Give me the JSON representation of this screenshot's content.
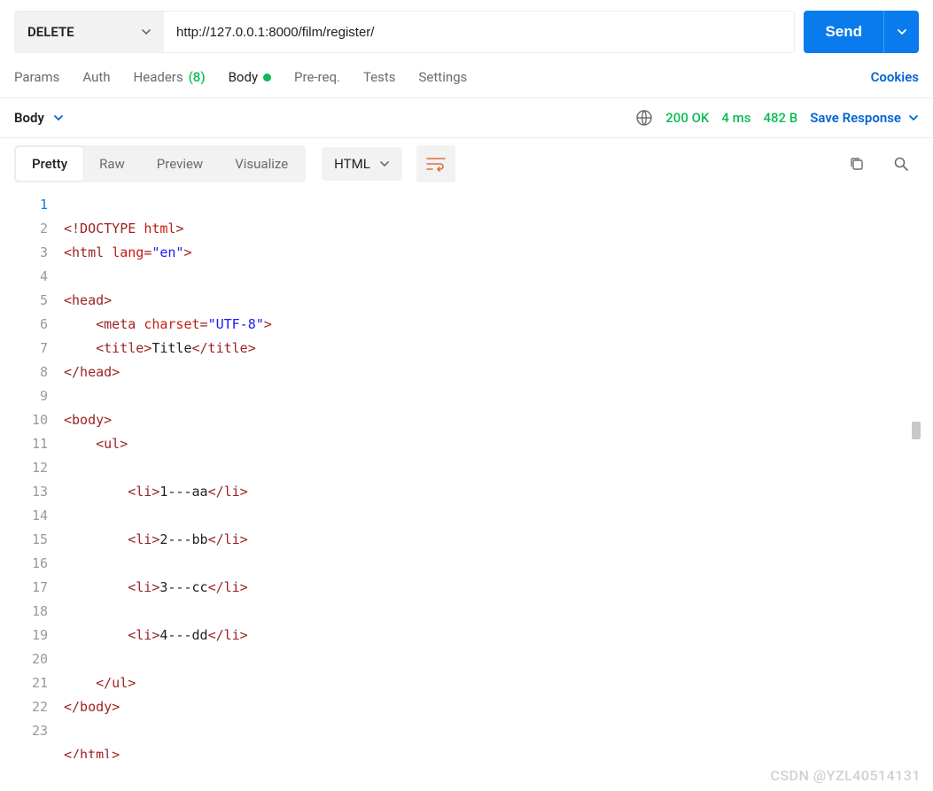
{
  "request": {
    "method": "DELETE",
    "url": "http://127.0.0.1:8000/film/register/",
    "send_label": "Send"
  },
  "tabs": {
    "params": "Params",
    "auth": "Auth",
    "headers": "Headers",
    "headers_count": "(8)",
    "body": "Body",
    "prereq": "Pre-req.",
    "tests": "Tests",
    "settings": "Settings",
    "cookies": "Cookies"
  },
  "response": {
    "section_label": "Body",
    "status": "200 OK",
    "time_label": "4",
    "time_unit": "ms",
    "size_label": "482",
    "size_unit": "B",
    "save_label": "Save Response"
  },
  "view": {
    "pretty": "Pretty",
    "raw": "Raw",
    "preview": "Preview",
    "visualize": "Visualize",
    "format": "HTML"
  },
  "code": {
    "line1_a": "<!DOCTYPE",
    "line1_b": "html",
    "line1_c": ">",
    "line2": "<html lang=\"en\">",
    "line4": "<head>",
    "line5": "    <meta charset=\"UTF-8\">",
    "line6_a": "    <title>",
    "line6_b": "Title",
    "line6_c": "</title>",
    "line7": "</head>",
    "line9": "<body>",
    "line10": "    <ul>",
    "li_open": "        <li>",
    "li_close": "</li>",
    "li1": "1---aa",
    "li2": "2---bb",
    "li3": "3---cc",
    "li4": "4---dd",
    "line20": "    </ul>",
    "line21": "</body>",
    "line23": "</html>"
  },
  "watermark": "CSDN @YZL40514131"
}
